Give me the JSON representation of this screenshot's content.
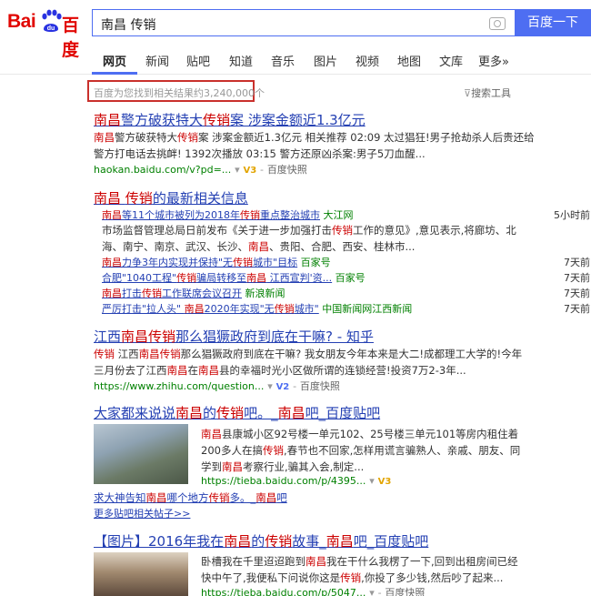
{
  "header": {
    "logo_bai": "Bai",
    "logo_du": "百度",
    "query": "南昌 传销",
    "search_button": "百度一下"
  },
  "tabs": [
    "网页",
    "新闻",
    "贴吧",
    "知道",
    "音乐",
    "图片",
    "视频",
    "地图",
    "文库",
    "更多»"
  ],
  "stats": "百度为您找到相关结果约3,240,000个",
  "search_tools": "搜索工具",
  "result1": {
    "title": "南昌警方破获特大传销案 涉案金额近1.3亿元",
    "line1": "南昌警方破获特大传销案 涉案金额近1.3亿元 相关推荐 02:09 太过猖狂!男子抢劫杀人后贵还给",
    "line2": "警方打电话去挑衅! 1392次播放 03:15 警方还原凶杀案:男子5刀血醒...",
    "url": "haokan.baidu.com/v?pd=...",
    "snapshot": "百度快照"
  },
  "news": {
    "title": "南昌 传销的最新相关信息",
    "items": [
      {
        "title": "南昌等11个城市被列为2018年传销重点整治城市",
        "source": "大江网",
        "time": "5小时前"
      },
      {
        "title": "南昌力争3年内实现并保持\"无传销城市\"目标",
        "source": "百家号",
        "time": "7天前"
      },
      {
        "title": "合肥\"1040工程\"传销骗局转移至南昌 江西宣判'资...",
        "source": "百家号",
        "time": "7天前"
      },
      {
        "title": "南昌打击传销工作联席会议召开",
        "source": "新浪新闻",
        "time": "7天前"
      },
      {
        "title": "严厉打击\"拉人头\" 南昌2020年实现\"无传销城市\"",
        "source": "中国新闻网江西新闻",
        "time": "7天前"
      }
    ],
    "sub1": "市场监督管理总局日前发布《关于进一步加强打击传销工作的意见》,意见表示,将廊坊、北",
    "sub2": "海、南宁、南京、武汉、长沙、南昌、贵阳、合肥、西安、桂林市..."
  },
  "result3": {
    "title": "江西南昌传销那么猖獗政府到底在干嘛? - 知乎",
    "line1": "传销 江西南昌传销那么猖獗政府到底在干嘛? 我女朋友今年本来是大二!成都理工大学的!今年",
    "line2": "三月份去了江西南昌在南昌县的幸福时光小区做所谓的连锁经营!投资7万2-3年...",
    "url": "https://www.zhihu.com/question...",
    "snapshot": "百度快照"
  },
  "result4": {
    "title": "大家都来说说南昌的传销吧。_南昌吧_百度贴吧",
    "line1": "南昌县康城小区92号楼一单元102、25号楼三单元101等房内租住着",
    "line2": "200多人在搞传销,春节也不回家,怎样用谎言骗熟人、亲戚、朋友、同",
    "line3": "学到南昌考察行业,骗其入会,制定...",
    "url": "https://tieba.baidu.com/p/4395...",
    "sub_link": "求大神告知南昌哪个地方传销多。_南昌吧",
    "more": "更多贴吧相关帖子>>"
  },
  "result5": {
    "title": "【图片】2016年我在南昌的传销故事_南昌吧_百度贴吧",
    "line1": "卧槽我在千里迢迢跑到南昌我在干什么我楞了一下,回到出租房间已经",
    "line2": "快中午了,我便私下问说你这是传销,你投了多少钱,然后吵了起来...",
    "url": "https://tieba.baidu.com/p/5047...",
    "snapshot": "百度快照"
  }
}
